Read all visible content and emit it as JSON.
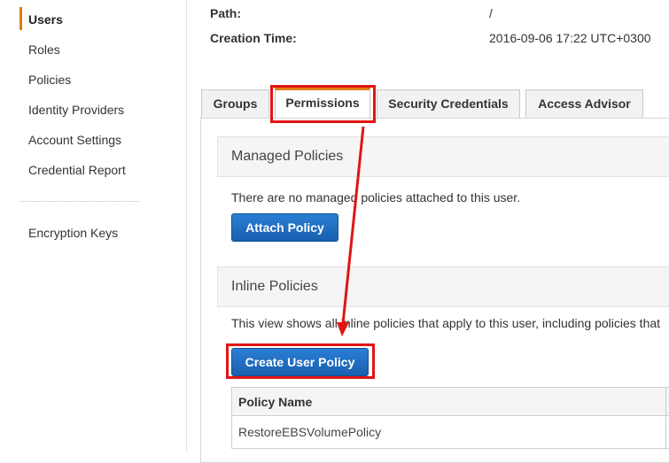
{
  "sidebar": {
    "items": [
      {
        "label": "Users",
        "active": true
      },
      {
        "label": "Roles"
      },
      {
        "label": "Policies"
      },
      {
        "label": "Identity Providers"
      },
      {
        "label": "Account Settings"
      },
      {
        "label": "Credential Report"
      },
      {
        "label": "Encryption Keys"
      }
    ],
    "accent_color": "#e07d10"
  },
  "details": {
    "path_label": "Path:",
    "path_value": "/",
    "creation_label": "Creation Time:",
    "creation_value": "2016-09-06 17:22 UTC+0300"
  },
  "tabs": [
    {
      "label": "Groups"
    },
    {
      "label": "Permissions",
      "active": true
    },
    {
      "label": "Security Credentials"
    },
    {
      "label": "Access Advisor"
    }
  ],
  "managed": {
    "title": "Managed Policies",
    "text": "There are no managed policies attached to this user.",
    "button": "Attach Policy"
  },
  "inline": {
    "title": "Inline Policies",
    "text": "This view shows all inline policies that apply to this user, including policies that",
    "button": "Create User Policy"
  },
  "policy_table": {
    "header": "Policy Name",
    "rows": [
      "RestoreEBSVolumePolicy"
    ]
  },
  "annotation_color": "#e01515",
  "button_color": "#1a6ac2"
}
